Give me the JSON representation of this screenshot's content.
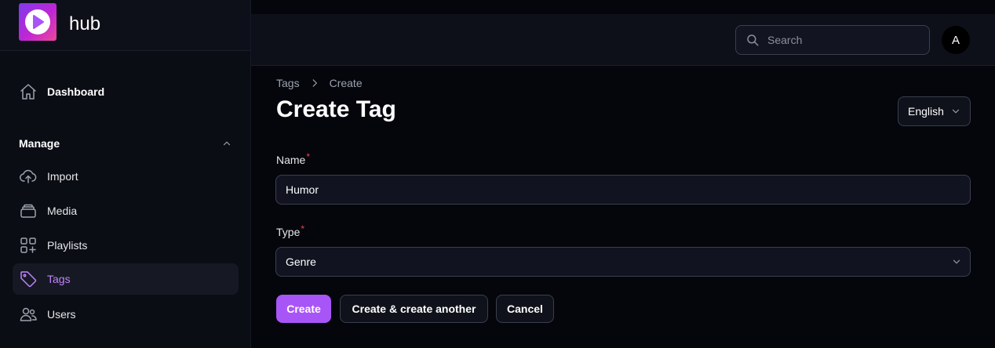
{
  "brand": {
    "name": "hub"
  },
  "sidebar": {
    "dashboard_label": "Dashboard",
    "group_label": "Manage",
    "items": [
      {
        "label": "Import",
        "icon": "cloud-upload-icon"
      },
      {
        "label": "Media",
        "icon": "stack-icon"
      },
      {
        "label": "Playlists",
        "icon": "squares-plus-icon"
      },
      {
        "label": "Tags",
        "icon": "tag-icon",
        "active": true
      },
      {
        "label": "Users",
        "icon": "users-icon"
      }
    ]
  },
  "topbar": {
    "search_placeholder": "Search",
    "avatar_initial": "A"
  },
  "breadcrumb": [
    "Tags",
    "Create"
  ],
  "page": {
    "title": "Create Tag",
    "language": "English"
  },
  "form": {
    "name_label": "Name",
    "name_value": "Humor",
    "type_label": "Type",
    "type_value": "Genre",
    "required_marker": "*"
  },
  "actions": {
    "create": "Create",
    "create_another": "Create & create another",
    "cancel": "Cancel"
  },
  "colors": {
    "accent": "#a855f7",
    "active_text": "#c084fc",
    "required": "#ef4444"
  }
}
